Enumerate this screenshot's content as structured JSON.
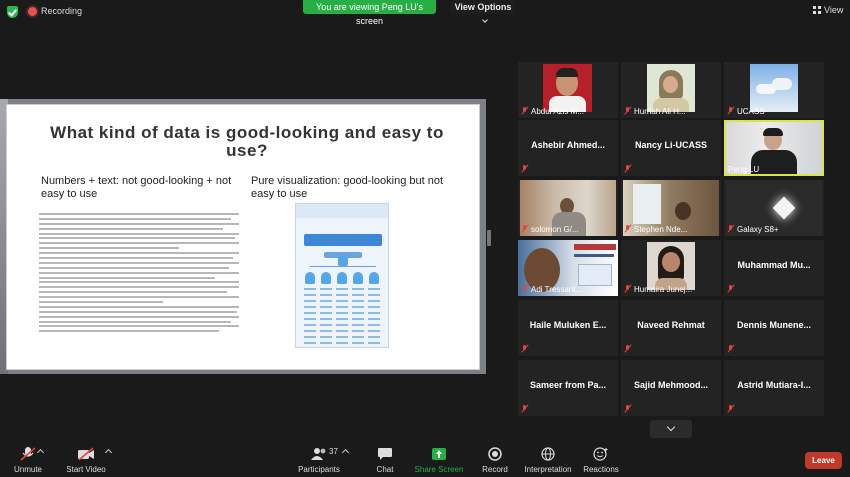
{
  "topbar": {
    "recording_label": "Recording",
    "viewing_banner": "You are viewing Peng LU's screen",
    "view_options_label": "View Options",
    "view_label": "View"
  },
  "slide": {
    "title": "What kind of data is good-looking and easy to use?",
    "left_heading": "Numbers + text: not good-looking + not easy to use",
    "right_heading": "Pure visualization: good-looking but not easy to use"
  },
  "participants": [
    {
      "name": "Abdul Azis M...",
      "muted": true
    },
    {
      "name": "Hurriah Ali H...",
      "muted": true
    },
    {
      "name": "UCASS",
      "muted": true
    },
    {
      "name": "Ashebir Ahmed...",
      "muted": true
    },
    {
      "name": "Nancy Li-UCASS",
      "muted": true
    },
    {
      "name": "Peng LU",
      "muted": false
    },
    {
      "name": "solomon G/...",
      "muted": true
    },
    {
      "name": "Stephen Nde...",
      "muted": true
    },
    {
      "name": "Galaxy S8+",
      "muted": true
    },
    {
      "name": "Adi Tressant...",
      "muted": true
    },
    {
      "name": "Humaira Junej...",
      "muted": true
    },
    {
      "name": "Muhammad Mu...",
      "muted": true
    },
    {
      "name": "Haile Muluken E...",
      "muted": true
    },
    {
      "name": "Naveed Rehmat",
      "muted": true
    },
    {
      "name": "Dennis Munene...",
      "muted": true
    },
    {
      "name": "Sameer from Pa...",
      "muted": true
    },
    {
      "name": "Sajid Mehmood...",
      "muted": true
    },
    {
      "name": "Astrid Mutiara-I...",
      "muted": true
    }
  ],
  "toolbar": {
    "unmute": "Unmute",
    "start_video": "Start Video",
    "participants": "Participants",
    "participants_count": "37",
    "chat": "Chat",
    "share_screen": "Share Screen",
    "record": "Record",
    "interpretation": "Interpretation",
    "reactions": "Reactions",
    "leave": "Leave"
  },
  "colors": {
    "share_green": "#27ae45",
    "leave_red": "#c0392b",
    "active_speaker": "#d9e64a",
    "mute_red": "#e0453e"
  }
}
